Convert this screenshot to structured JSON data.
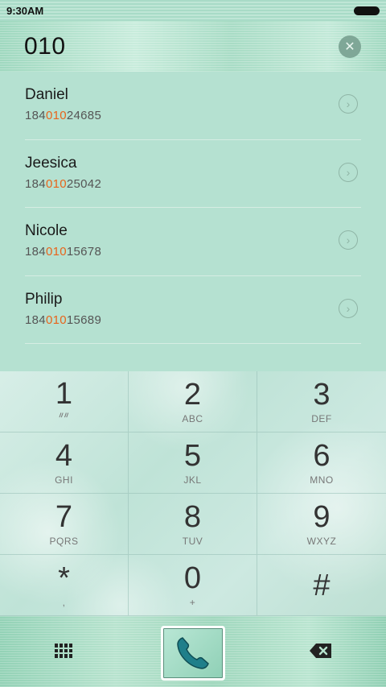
{
  "status_bar": {
    "time": "9:30AM"
  },
  "dial": {
    "number": "010"
  },
  "contacts": [
    {
      "name": "Daniel",
      "number_prefix": "184",
      "number_match": "010",
      "number_suffix": "24685"
    },
    {
      "name": "Jeesica",
      "number_prefix": "184",
      "number_match": "010",
      "number_suffix": "25042"
    },
    {
      "name": "Nicole",
      "number_prefix": "184",
      "number_match": "010",
      "number_suffix": "15678"
    },
    {
      "name": "Philip",
      "number_prefix": "184",
      "number_match": "010",
      "number_suffix": "15689"
    }
  ],
  "keypad": [
    {
      "digit": "1",
      "sub": ""
    },
    {
      "digit": "2",
      "sub": "ABC"
    },
    {
      "digit": "3",
      "sub": "DEF"
    },
    {
      "digit": "4",
      "sub": "GHI"
    },
    {
      "digit": "5",
      "sub": "JKL"
    },
    {
      "digit": "6",
      "sub": "MNO"
    },
    {
      "digit": "7",
      "sub": "PQRS"
    },
    {
      "digit": "8",
      "sub": "TUV"
    },
    {
      "digit": "9",
      "sub": "WXYZ"
    },
    {
      "digit": "*",
      "sub": ","
    },
    {
      "digit": "0",
      "sub": "+"
    },
    {
      "digit": "#",
      "sub": ""
    }
  ],
  "icons": {
    "battery": "battery-icon",
    "clear": "clear-icon",
    "chevron": "chevron-right-icon",
    "voicemail": "voicemail-icon",
    "dialpad": "dialpad-icon",
    "phone": "phone-icon",
    "delete": "backspace-icon"
  },
  "colors": {
    "highlight": "#e8641b",
    "call_icon": "#1f7f8a"
  }
}
